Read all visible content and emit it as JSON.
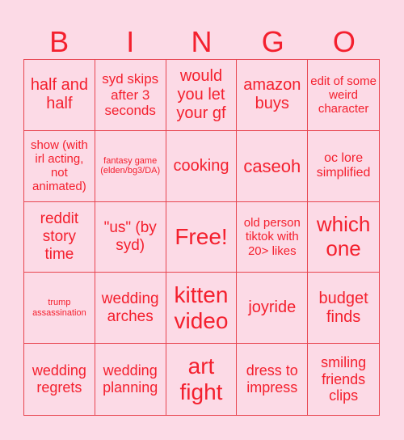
{
  "header": [
    "B",
    "I",
    "N",
    "G",
    "O"
  ],
  "cells": [
    "half and half",
    "syd skips after 3 seconds",
    "would you let your gf",
    "amazon buys",
    "edit of some weird character",
    "show (with irl acting, not animated)",
    "fantasy game (elden/bg3/DA)",
    "cooking",
    "caseoh",
    "oc lore simplified",
    "reddit story time",
    "\"us\" (by syd)",
    "Free!",
    "old person tiktok with 20> likes",
    "which one",
    "trump assassination",
    "wedding arches",
    "kitten video",
    "joyride",
    "budget finds",
    "wedding regrets",
    "wedding planning",
    "art fight",
    "dress to impress",
    "smiling friends clips"
  ],
  "colors": {
    "background": "#fcdae6",
    "text": "#f4202e",
    "grid": "#e84550"
  }
}
